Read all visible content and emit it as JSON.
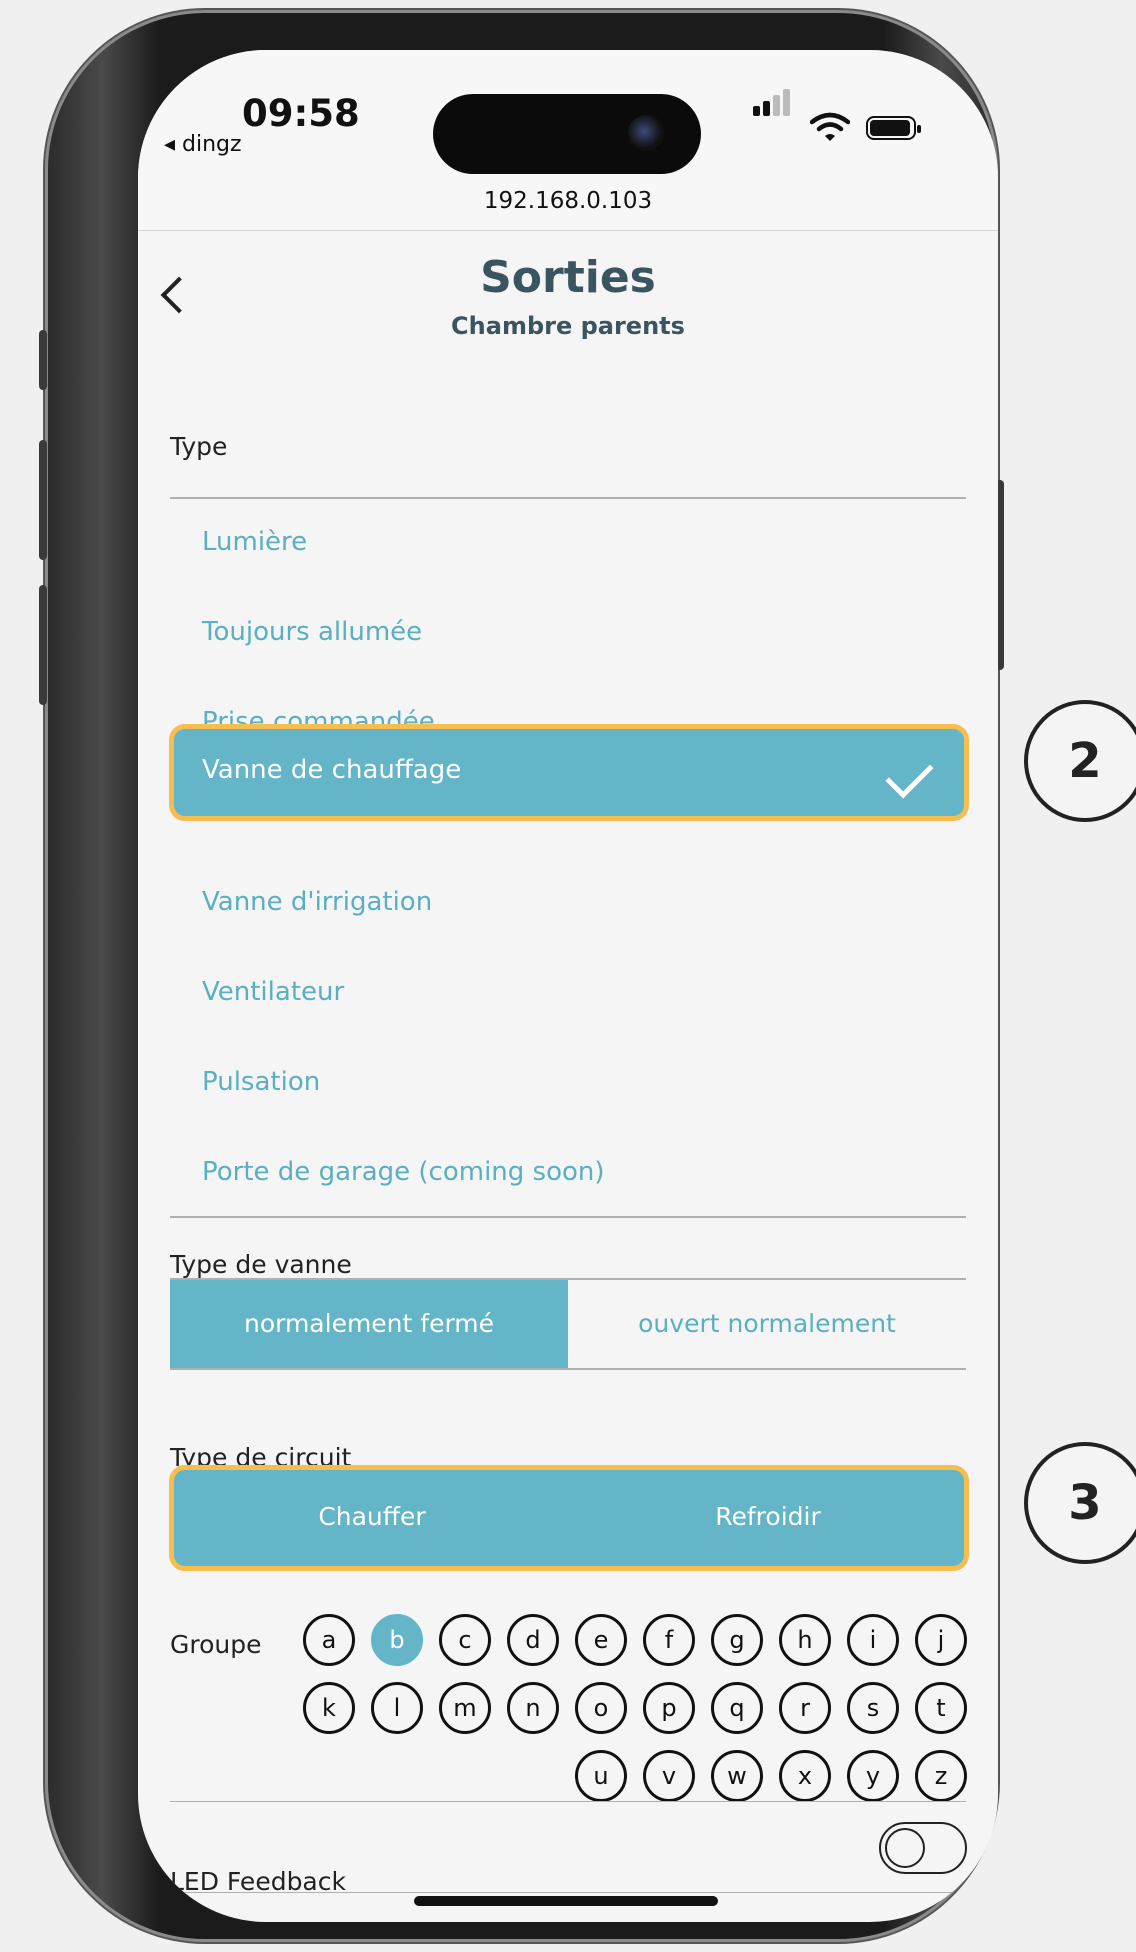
{
  "status_bar": {
    "time": "09:58",
    "back_app": "◂ dingz",
    "url": "192.168.0.103"
  },
  "header": {
    "title": "Sorties",
    "subtitle": "Chambre parents"
  },
  "type_section": {
    "label": "Type",
    "options": [
      "Lumière",
      "Toujours allumée",
      "Prise commandée",
      "Vanne de chauffage",
      "Vanne d'irrigation",
      "Ventilateur",
      "Pulsation",
      "Porte de garage (coming soon)"
    ],
    "selected": "Vanne de chauffage"
  },
  "valve_type": {
    "label": "Type de vanne",
    "options": [
      "normalement fermé",
      "ouvert normalement"
    ],
    "selected": "normalement fermé"
  },
  "circuit_type": {
    "label": "Type de circuit",
    "options": [
      "Chauffer",
      "Refroidir"
    ]
  },
  "group": {
    "label": "Groupe",
    "letters": [
      "a",
      "b",
      "c",
      "d",
      "e",
      "f",
      "g",
      "h",
      "i",
      "j",
      "k",
      "l",
      "m",
      "n",
      "o",
      "p",
      "q",
      "r",
      "s",
      "t",
      "u",
      "v",
      "w",
      "x",
      "y",
      "z"
    ],
    "selected": "b"
  },
  "led_feedback": {
    "label": "LED Feedback",
    "enabled": false
  },
  "annotations": [
    "2",
    "3"
  ],
  "colors": {
    "accent": "#63b5c7",
    "highlight": "#f6bd4f",
    "title": "#3a5560"
  }
}
